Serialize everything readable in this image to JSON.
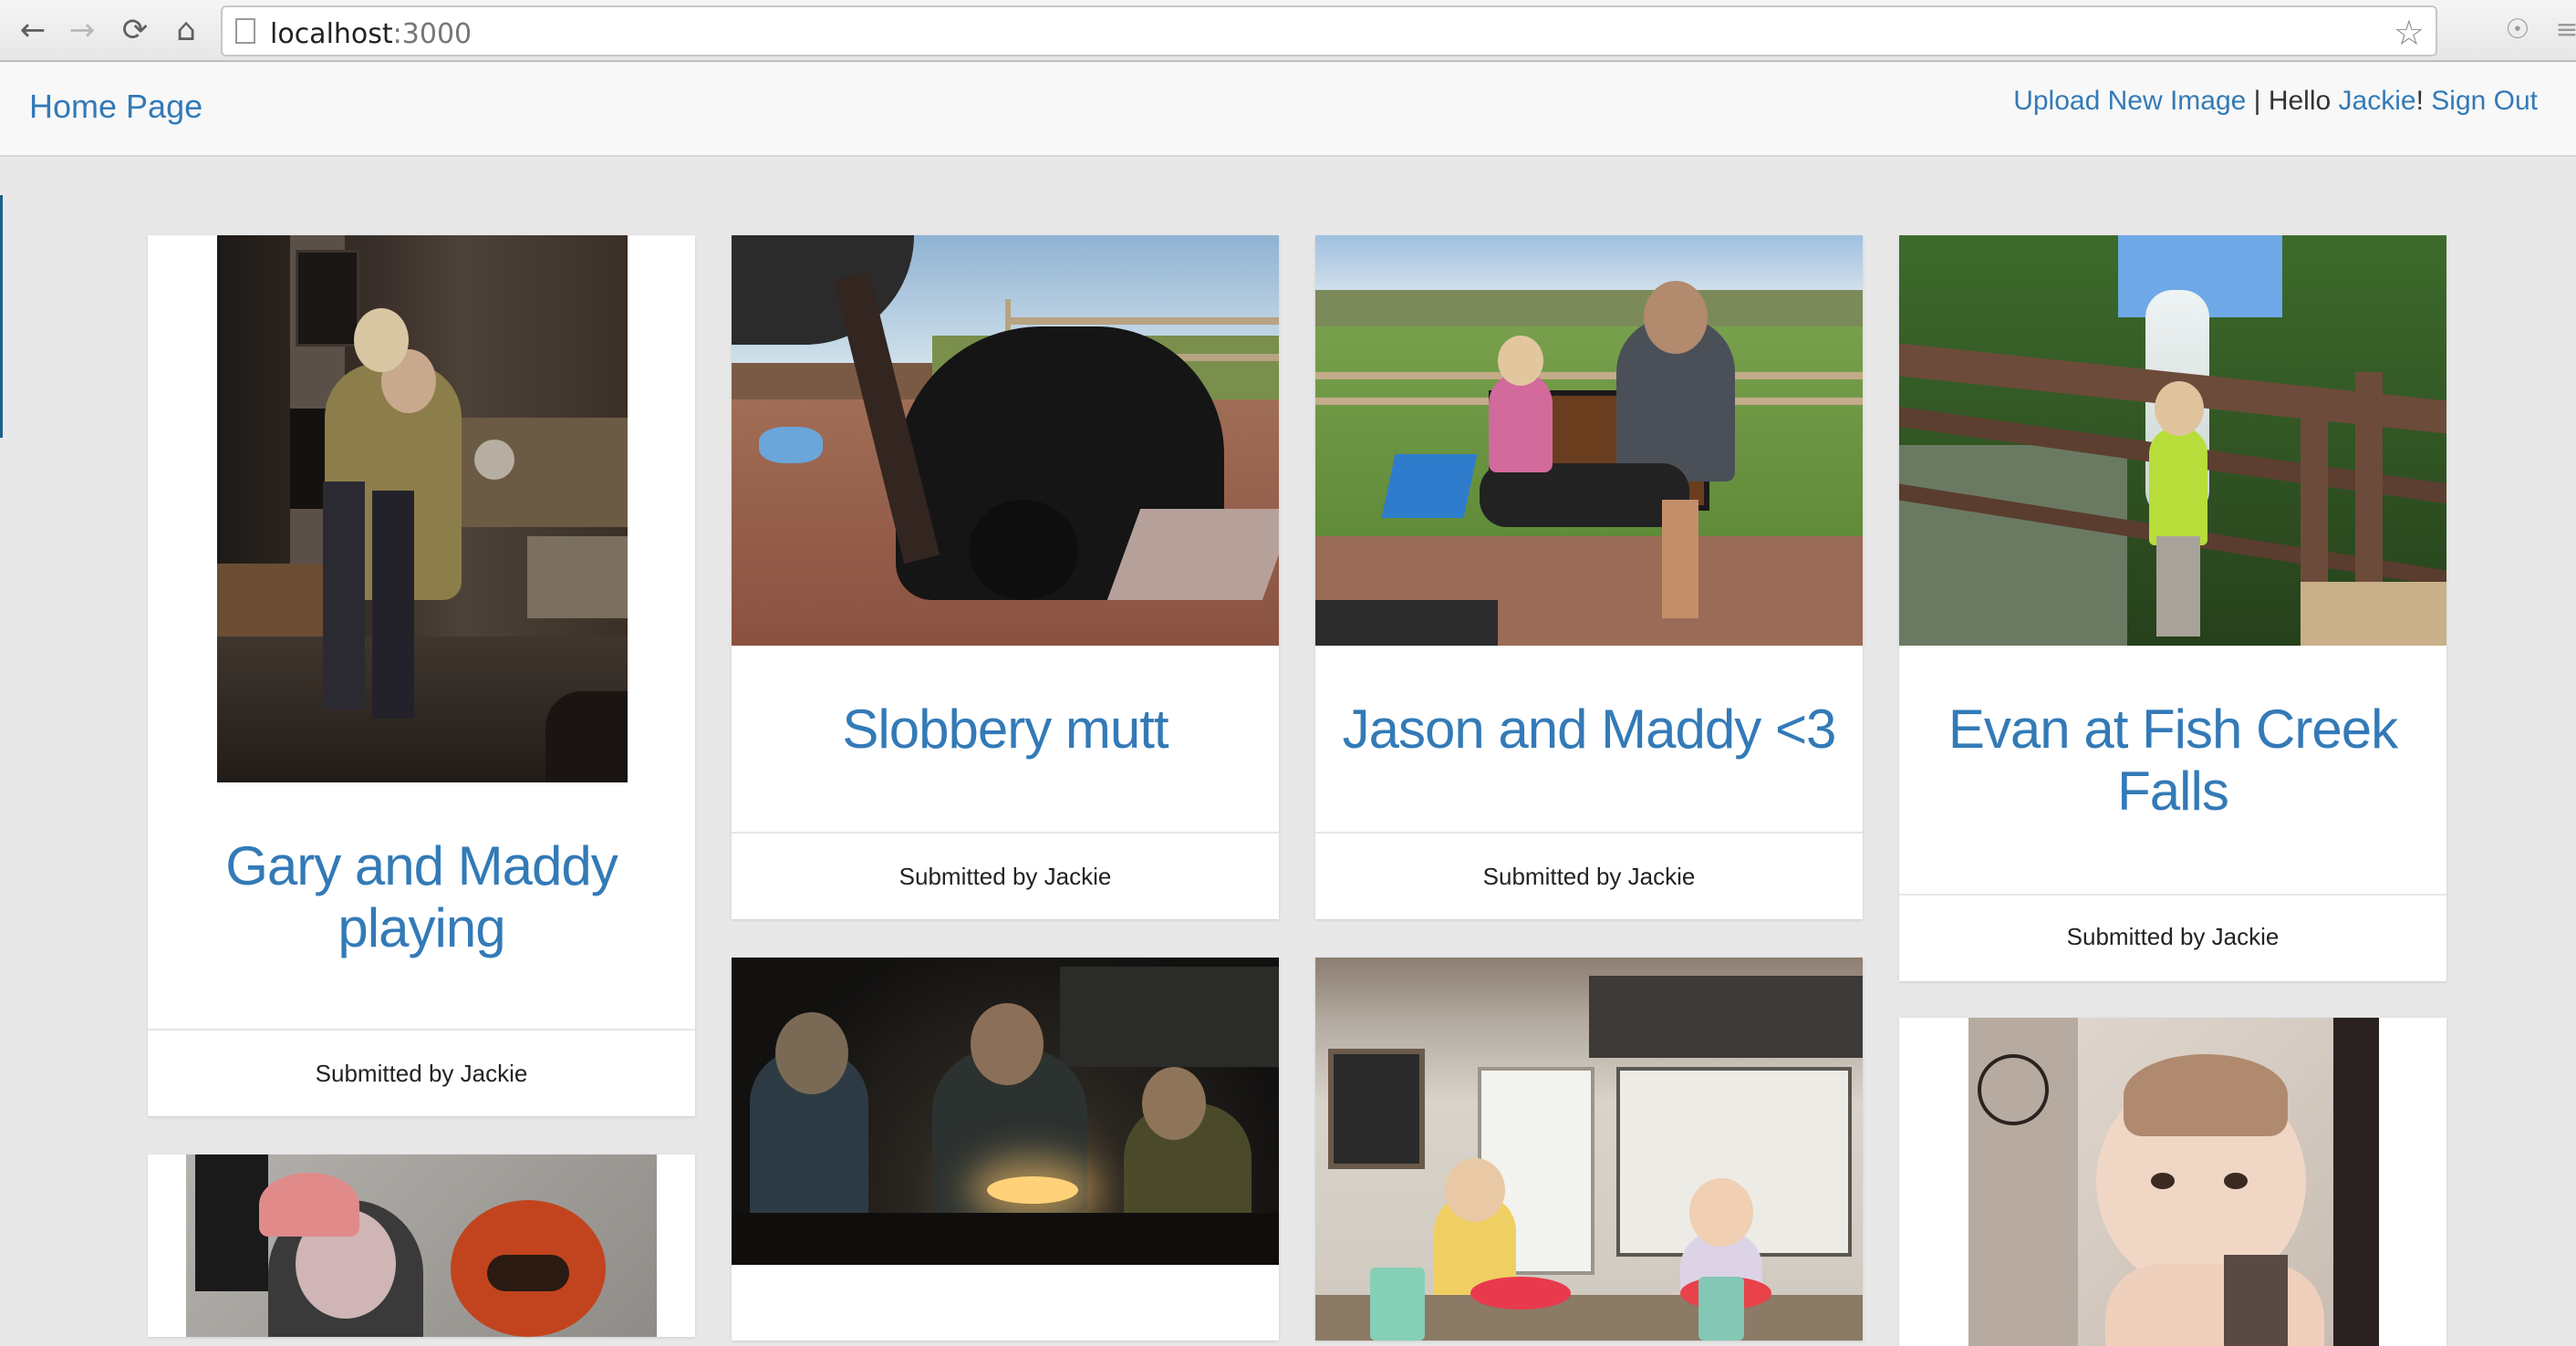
{
  "browser": {
    "url_host": "localhost",
    "url_port": ":3000",
    "icons": [
      "back-arrow-icon",
      "forward-arrow-icon",
      "reload-icon",
      "home-icon",
      "bookmark-star-icon",
      "extension-icon",
      "menu-icon"
    ]
  },
  "navbar": {
    "brand": "Home Page",
    "upload_link": "Upload New Image",
    "separator": "|",
    "hello_text": "Hello",
    "user_link": "Jackie",
    "exclaim": "!",
    "signout_link": "Sign Out"
  },
  "cards": [
    {
      "title_line1": "Gary and Maddy",
      "title_line2": "playing",
      "submitted": "Submitted by Jackie"
    },
    {
      "title_line1": "Slobbery mutt",
      "submitted": "Submitted by Jackie"
    },
    {
      "title_line1": "Jason and Maddy <3",
      "submitted": "Submitted by Jackie"
    },
    {
      "title_line1": "Evan at Fish Creek",
      "title_line2": "Falls",
      "submitted": "Submitted by Jackie"
    }
  ],
  "colors": {
    "link": "#337ab7",
    "page_bg": "#e8e8e8",
    "navbar_bg": "#f8f8f8"
  }
}
